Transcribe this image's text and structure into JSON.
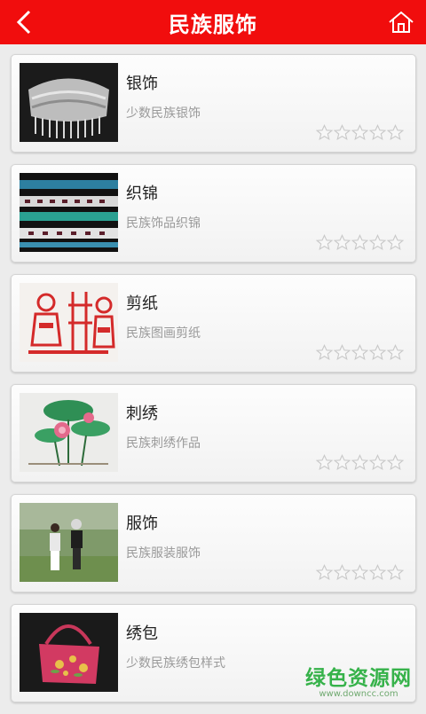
{
  "header": {
    "title": "民族服饰",
    "back_icon": "chevron-left-icon",
    "home_icon": "home-icon",
    "bg_color": "#f10d0d"
  },
  "items": [
    {
      "name": "银饰",
      "desc": "少数民族银饰",
      "rating": 0
    },
    {
      "name": "织锦",
      "desc": "民族饰品织锦",
      "rating": 0
    },
    {
      "name": "剪纸",
      "desc": "民族图画剪纸",
      "rating": 0
    },
    {
      "name": "刺绣",
      "desc": "民族刺绣作品",
      "rating": 0
    },
    {
      "name": "服饰",
      "desc": "民族服装服饰",
      "rating": 0
    },
    {
      "name": "绣包",
      "desc": "少数民族绣包样式",
      "rating": 0
    }
  ],
  "watermark": {
    "title": "绿色资源网",
    "url": "www.downcc.com"
  }
}
